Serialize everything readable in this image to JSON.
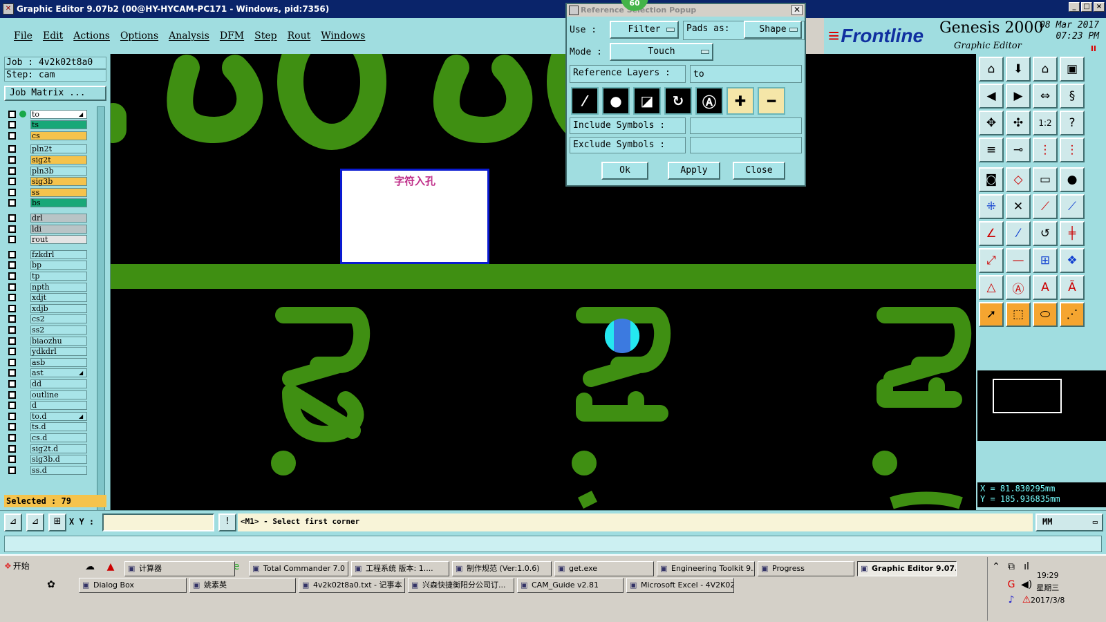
{
  "window": {
    "title": "Graphic Editor 9.07b2 (00@HY-HYCAM-PC171 - Windows, pid:7356)",
    "controls": [
      "_",
      "□",
      "×"
    ]
  },
  "menu": [
    "File",
    "Edit",
    "Actions",
    "Options",
    "Analysis",
    "DFM",
    "Step",
    "Rout",
    "Windows"
  ],
  "brand": {
    "logo": "Frontline",
    "product": "Genesis 2000",
    "subtitle": "Graphic Editor",
    "date": "08 Mar 2017",
    "time": "07:23 PM",
    "pause": "II"
  },
  "job": {
    "job_line": "Job : 4v2k02t8a0",
    "step_line": "Step: cam",
    "job_matrix": "Job Matrix ...",
    "selected": "Selected : 79"
  },
  "layers": [
    {
      "name": "to",
      "color": "#ffffff",
      "active": true,
      "marker": true
    },
    {
      "name": "ts",
      "color": "#18a878"
    },
    {
      "name": "cs",
      "color": "#f5c34c"
    },
    {
      "name": "pln2t",
      "color": "#a8e4e8"
    },
    {
      "name": "sig2t",
      "color": "#f5c34c"
    },
    {
      "name": "pln3b",
      "color": "#a8e4e8"
    },
    {
      "name": "sig3b",
      "color": "#f5c34c"
    },
    {
      "name": "ss",
      "color": "#f5c34c"
    },
    {
      "name": "bs",
      "color": "#18a878"
    },
    {
      "name": "drl",
      "color": "#b8c4c6"
    },
    {
      "name": "ldi",
      "color": "#b8c4c6"
    },
    {
      "name": "rout",
      "color": "#e4e4e4"
    },
    {
      "name": "fzkdrl",
      "color": "#a8e4e8"
    },
    {
      "name": "bp",
      "color": "#a8e4e8"
    },
    {
      "name": "tp",
      "color": "#a8e4e8"
    },
    {
      "name": "npth",
      "color": "#a8e4e8"
    },
    {
      "name": "xdjt",
      "color": "#a8e4e8"
    },
    {
      "name": "xdjb",
      "color": "#a8e4e8"
    },
    {
      "name": "cs2",
      "color": "#a8e4e8"
    },
    {
      "name": "ss2",
      "color": "#a8e4e8"
    },
    {
      "name": "biaozhu",
      "color": "#a8e4e8"
    },
    {
      "name": "ydkdrl",
      "color": "#a8e4e8"
    },
    {
      "name": "asb",
      "color": "#a8e4e8"
    },
    {
      "name": "ast",
      "color": "#a8e4e8",
      "marker": true
    },
    {
      "name": "dd",
      "color": "#a8e4e8"
    },
    {
      "name": "outline",
      "color": "#a8e4e8"
    },
    {
      "name": "d",
      "color": "#a8e4e8"
    },
    {
      "name": "to.d",
      "color": "#a8e4e8",
      "marker": true
    },
    {
      "name": "ts.d",
      "color": "#a8e4e8"
    },
    {
      "name": "cs.d",
      "color": "#a8e4e8"
    },
    {
      "name": "sig2t.d",
      "color": "#a8e4e8"
    },
    {
      "name": "sig3b.d",
      "color": "#a8e4e8"
    },
    {
      "name": "ss.d",
      "color": "#a8e4e8"
    }
  ],
  "canvas": {
    "note_text": "字符入孔",
    "labels": [
      "R2.",
      "R1.",
      "R1."
    ],
    "feature_color": "#3f8f12"
  },
  "popup": {
    "title": "Reference Selection Popup",
    "badge": "60",
    "use_label": "Use :",
    "use_value": "Filter",
    "pads_label": "Pads as:",
    "pads_value": "Shape",
    "mode_label": "Mode :",
    "mode_value": "Touch",
    "ref_layers_label": "Reference Layers :",
    "ref_layers_value": "to",
    "include_label": "Include Symbols :",
    "include_value": "",
    "exclude_label": "Exclude Symbols :",
    "exclude_value": "",
    "ok": "Ok",
    "apply": "Apply",
    "close": "Close"
  },
  "command": {
    "xy_label": "X Y :",
    "xy_value": "",
    "prompt": "<M1> - Select first corner",
    "units": "MM"
  },
  "coords": {
    "x": "X = 81.830295mm",
    "y": "Y = 185.936835mm"
  },
  "taskbar": {
    "start": "开始",
    "row1": [
      "计算器",
      "Total Commander 7.0 ...",
      "工程系统  版本: 1....",
      "制作规范 (Ver:1.0.6)",
      "get.exe",
      "Engineering Toolkit 9....",
      "Progress",
      "Graphic Editor 9.07..."
    ],
    "row2": [
      "Dialog Box",
      "姚素英",
      "4v2k02t8a0.txt - 记事本",
      "兴森快捷衡阳分公司订...",
      "CAM_Guide v2.81",
      "Microsoft Excel - 4V2K02..."
    ],
    "clock_time": "19:29",
    "clock_day": "星期三",
    "clock_date": "2017/3/8"
  }
}
